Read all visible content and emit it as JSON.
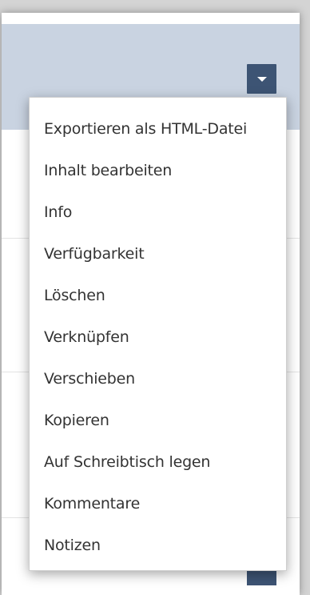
{
  "menu": {
    "items": [
      {
        "label": "Exportieren als HTML-Datei"
      },
      {
        "label": "Inhalt bearbeiten"
      },
      {
        "label": "Info"
      },
      {
        "label": "Verfügbarkeit"
      },
      {
        "label": "Löschen"
      },
      {
        "label": "Verknüpfen"
      },
      {
        "label": "Verschieben"
      },
      {
        "label": "Kopieren"
      },
      {
        "label": "Auf Schreibtisch legen"
      },
      {
        "label": "Kommentare"
      },
      {
        "label": "Notizen"
      }
    ]
  },
  "icons": {
    "dropdown_toggle": "caret-down-icon"
  },
  "colors": {
    "header_band": "#c9d3e1",
    "toggle_button": "#3d5474",
    "menu_text": "#333333"
  }
}
